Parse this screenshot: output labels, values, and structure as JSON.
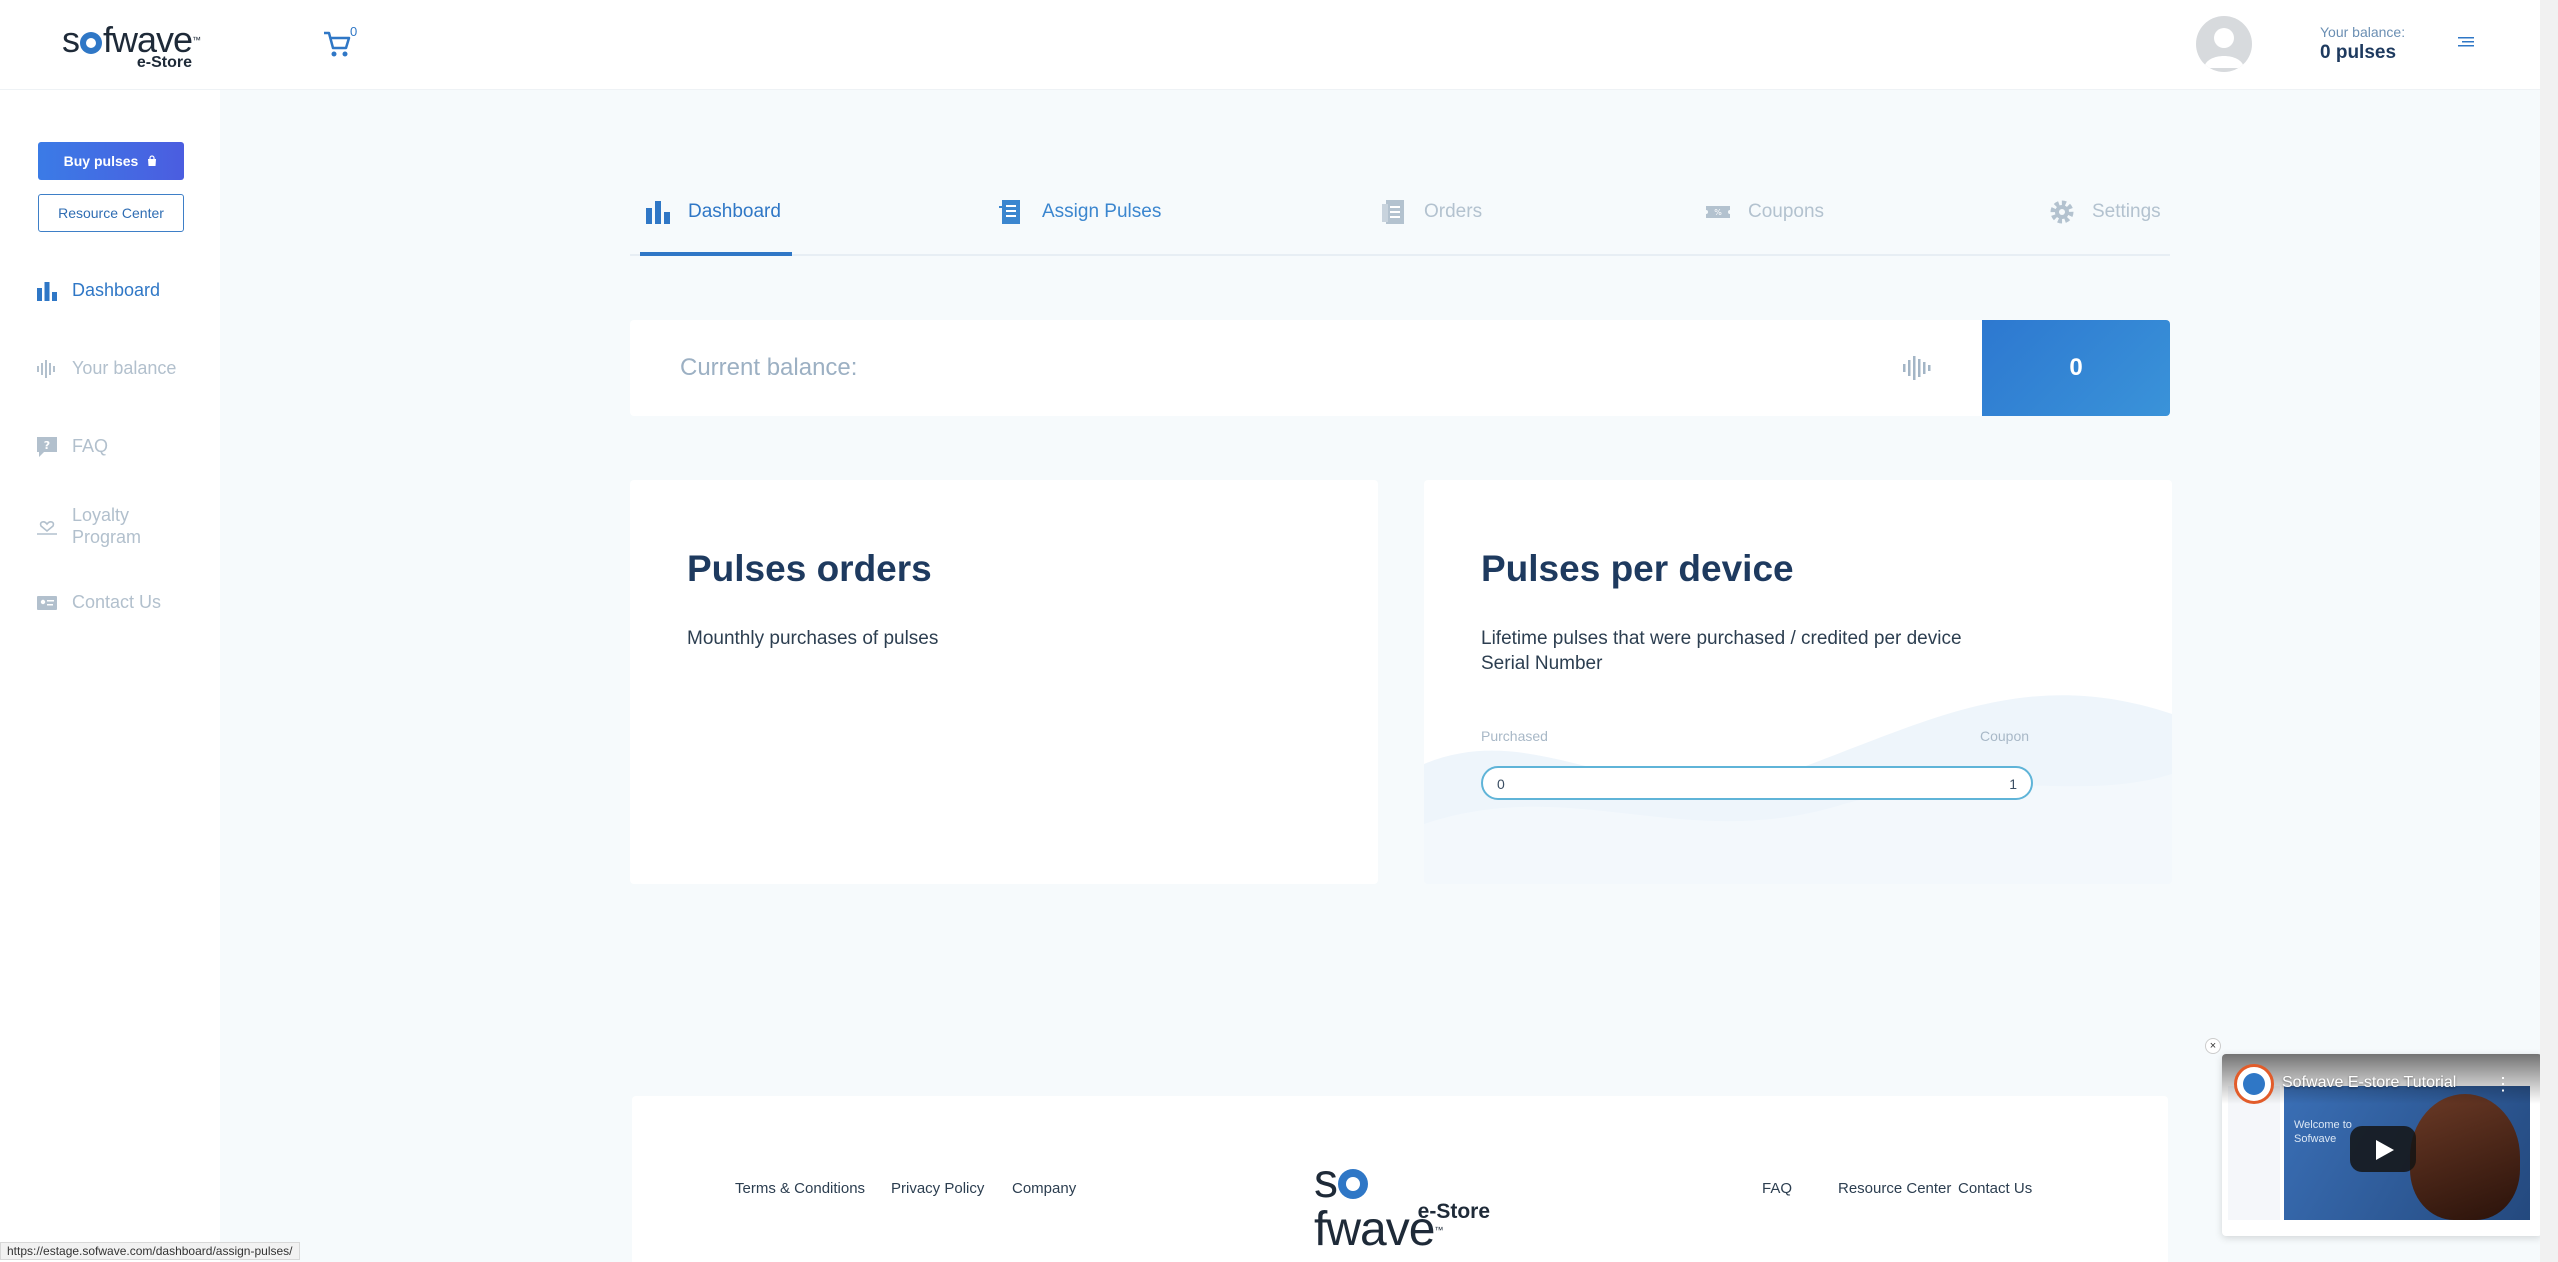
{
  "header": {
    "logo_text": "sofwave",
    "logo_tm": "™",
    "logo_sub": "e-Store",
    "cart_count": "0",
    "balance_label": "Your balance:",
    "balance_value": "0 pulses"
  },
  "sidebar": {
    "buy_label": "Buy pulses",
    "resource_label": "Resource Center",
    "items": [
      {
        "label": "Dashboard",
        "icon": "bar-chart-icon"
      },
      {
        "label": "Your balance",
        "icon": "wave-icon"
      },
      {
        "label": "FAQ",
        "icon": "question-icon"
      },
      {
        "label": "Loyalty Program",
        "icon": "heart-hand-icon"
      },
      {
        "label": "Contact Us",
        "icon": "contact-card-icon"
      }
    ]
  },
  "tabs": [
    {
      "label": "Dashboard",
      "icon": "bar-chart-icon"
    },
    {
      "label": "Assign Pulses",
      "icon": "assign-icon"
    },
    {
      "label": "Orders",
      "icon": "orders-icon"
    },
    {
      "label": "Coupons",
      "icon": "coupon-icon"
    },
    {
      "label": "Settings",
      "icon": "gear-icon"
    }
  ],
  "balance_card": {
    "title": "Current balance:",
    "value": "0"
  },
  "orders_panel": {
    "title": "Pulses orders",
    "desc": "Mounthly purchases of pulses"
  },
  "device_panel": {
    "title": "Pulses per device",
    "desc": "Lifetime pulses that were purchased / credited per device Serial Number",
    "purchased_label": "Purchased",
    "coupon_label": "Coupon",
    "purchased_value": "0",
    "coupon_value": "1"
  },
  "footer": {
    "links_left": [
      "Terms & Conditions",
      "Privacy Policy",
      "Company"
    ],
    "links_right": [
      "FAQ",
      "Resource Center",
      "Contact Us"
    ],
    "logo_text": "sofwave",
    "logo_tm": "™",
    "logo_sub": "e-Store"
  },
  "status_url": "https://estage.sofwave.com/dashboard/assign-pulses/",
  "video": {
    "title": "Sofwave E-store Tutorial",
    "close": "×",
    "kebab": "⋮",
    "welcome": "Welcome to Sofwave"
  },
  "colors": {
    "accent": "#2f77c6",
    "muted": "#b3c2cf",
    "heading": "#1e3a5f"
  }
}
